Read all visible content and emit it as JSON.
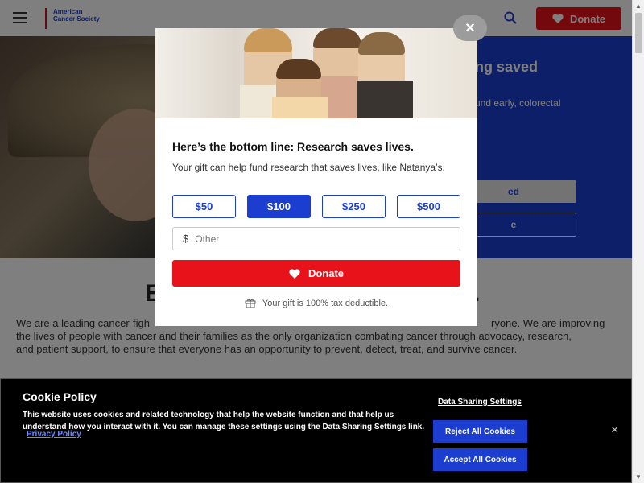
{
  "header": {
    "logo_text": "American Cancer Society",
    "donate_label": "Donate"
  },
  "hero": {
    "title": "ng saved",
    "text": "und early, colorectal",
    "btn1": "ed",
    "btn2": "e"
  },
  "section": {
    "heading_start": "E",
    "heading_end": ".",
    "text_start": "We are a leading cancer-figh",
    "text_end": "ryone. We are improving",
    "line2": "the lives of people with cancer and their families as the only organization combating cancer through advocacy, research,",
    "line3": "and patient support, to ensure that everyone has an opportunity to prevent, detect, treat, and survive cancer."
  },
  "modal": {
    "close_label": "×",
    "title": "Here’s the bottom line: Research saves lives.",
    "text": "Your gift can help fund research that saves lives, like Natanya’s.",
    "amounts": [
      "$50",
      "$100",
      "$250",
      "$500"
    ],
    "selected_amount": "$100",
    "other_placeholder": "Other",
    "currency_symbol": "$",
    "donate_label": "Donate",
    "tax_text": "Your gift is 100% tax deductible."
  },
  "cookie": {
    "title": "Cookie Policy",
    "text": "This website uses cookies and related technology that help the website function and that help us understand how you interact with it. You can manage these settings using the Data Sharing Settings link.",
    "privacy_link": "Privacy Policy",
    "data_sharing_label": "Data Sharing Settings",
    "reject_label": "Reject All Cookies",
    "accept_label": "Accept All Cookies",
    "close_label": "×"
  },
  "colors": {
    "brand_blue": "#1b3ed1",
    "donate_red": "#e8121a"
  }
}
